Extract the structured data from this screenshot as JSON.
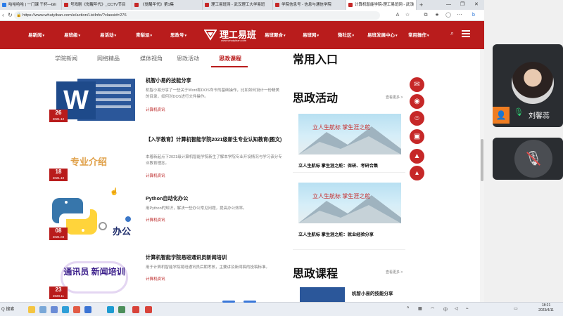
{
  "browser": {
    "tabs": [
      {
        "label": "哈哈哈哈 | 一门课 干杯—bili",
        "color": "#2b7de9"
      },
      {
        "label": "号戏剧《觉醒年代》_CCTV节目",
        "color": "#c62828"
      },
      {
        "label": "《觉醒年代》第1集",
        "color": "#c62828"
      },
      {
        "label": "理工易班网 - 武汉理工大学易班",
        "color": "#c62828"
      },
      {
        "label": "学院信息号 - 信息与通信学院",
        "color": "#c62828"
      },
      {
        "label": "计算机智能学院-理工易班网 - 武汉",
        "color": "#c62828"
      }
    ],
    "new_tab": "+",
    "url": "https://www.whutyiban.com/e/action/ListInfo/?classid=276",
    "window_controls": [
      "—",
      "❐",
      "✕"
    ]
  },
  "site": {
    "nav_left": [
      "易新闻",
      "易班级",
      "易活动",
      "青梨派",
      "思政号"
    ],
    "logo_text": "理工易班",
    "logo_url": "www.whutyiban.com",
    "nav_right": [
      "易班聚合",
      "易班网",
      "微社区",
      "易班发展中心",
      "常用操作"
    ]
  },
  "content_tabs": [
    "学院新闻",
    "网络精品",
    "媒体视角",
    "思政活动",
    "思政课程"
  ],
  "articles": [
    {
      "title": "机智小易的技能分享",
      "desc": "机智小易分享了一些关于Word和DOS命令的基础操作，比如如何设计一份精美的目录，如何对DOS进行文件操作。",
      "tag": "计算机资讯",
      "day": "26",
      "ym": "2021.12",
      "thumb": "word"
    },
    {
      "title": "【入学教育】计算机智能学院2021级新生专业认知教育(图文)",
      "desc": "本着新起点下2021级计算机智能学院新生了解本学院专业开设情况与学习该分专业教育理念。",
      "tag": "计算机资讯",
      "day": "18",
      "ym": "2021.10",
      "thumb": "专业介绍"
    },
    {
      "title": "Python自动化办公",
      "desc": "用Python的知识，解决一些办公常见问题，提高办公效率。",
      "tag": "计算机资讯",
      "day": "08",
      "ym": "2021.03",
      "thumb": "python",
      "thumb_text": "办公"
    },
    {
      "title": "计算机智能学院易班通讯员新闻培训",
      "desc": "用于计算机智能学院易班通讯员后期考核，主要讲及新闻稿的投稿标准。",
      "tag": "计算机资讯",
      "day": "23",
      "ym": "2020.11",
      "thumb": "training",
      "thumb_text": "通讯员 新闻培训"
    }
  ],
  "sidebar": {
    "common_title": "常用入口",
    "activity_title": "思政活动",
    "more": "查看更多 >",
    "activity_cards": [
      {
        "caption": "立人生航标 掌生涯之舵：保研、考研合集",
        "banner": "立人生航标 掌生涯之舵"
      },
      {
        "caption": "立人生航标 掌生涯之舵：就业经验分享",
        "banner": "立人生航标 掌生涯之舵"
      }
    ],
    "course_title": "思政课程",
    "course_item": "机智小易的技能分享"
  },
  "social_icons": [
    "wechat-icon",
    "qq-icon",
    "weibo-icon",
    "tv-icon",
    "top-icon"
  ],
  "meeting": {
    "user_name": "刘馨蕊"
  },
  "taskbar": {
    "search_label": "Q 搜索",
    "clock_time": "18:21",
    "clock_date": "2023/4/11",
    "lang": "中"
  }
}
